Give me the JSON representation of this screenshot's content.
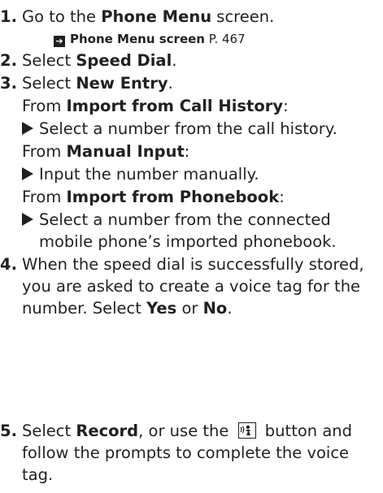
{
  "steps": {
    "s1": {
      "num": "1.",
      "pre": "Go to the ",
      "bold": "Phone Menu",
      "post": " screen."
    },
    "s1_ref": {
      "bold": "Phone Menu screen",
      "post": " P. 467"
    },
    "s2": {
      "num": "2.",
      "pre": "Select ",
      "bold": "Speed Dial",
      "post": "."
    },
    "s3": {
      "num": "3.",
      "pre": "Select ",
      "bold": "New Entry",
      "post": "."
    },
    "from_call_history": {
      "pre": "From ",
      "bold": "Import from Call History",
      "post": ":"
    },
    "call_history_detail": "Select a number from the call history.",
    "from_manual": {
      "pre": "From ",
      "bold": "Manual Input",
      "post": ":"
    },
    "manual_detail": "Input the number manually.",
    "from_phonebook": {
      "pre": "From ",
      "bold": "Import from Phonebook",
      "post": ":"
    },
    "phonebook_detail_1": "Select a number from the connected",
    "phonebook_detail_2": "mobile phone’s imported phonebook.",
    "s4": {
      "num": "4.",
      "line1": "When the speed dial is successfully stored,",
      "line2": "you are asked to create a voice tag for the",
      "line3_pre": "number. Select ",
      "yes": "Yes",
      "or": " or ",
      "no": "No",
      "line3_post": "."
    },
    "s5": {
      "num": "5.",
      "pre": "Select ",
      "bold": "Record",
      "mid": ", or use the ",
      "post": " button and",
      "line2": "follow the prompts to complete the voice",
      "line3": "tag."
    }
  },
  "icons": {
    "reference": "reference-arrow-icon",
    "bullet": "triangle-bullet-icon",
    "talk": "talk-button-icon"
  }
}
